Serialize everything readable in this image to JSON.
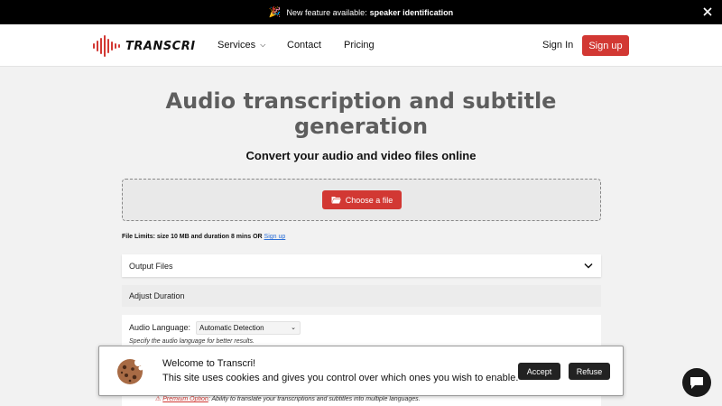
{
  "announcement": {
    "prefix": "New feature available:",
    "highlight": "speaker identification",
    "icon": "party-popper-icon"
  },
  "nav": {
    "logo_text": "TRANSCRI",
    "items": [
      "Services",
      "Contact",
      "Pricing"
    ],
    "signin": "Sign In",
    "signup": "Sign up"
  },
  "hero": {
    "title_line1": "Audio transcription and subtitle",
    "title_line2": "generation",
    "subtitle": "Convert your audio and video files online"
  },
  "upload": {
    "button": "Choose a file",
    "limits_text": "File Limits: size 10 MB and duration 8 mins OR",
    "limits_link": "Sign up"
  },
  "options": {
    "output_files": "Output Files",
    "adjust_duration": "Adjust Duration",
    "audio_language_label": "Audio Language:",
    "audio_language_value": "Automatic Detection",
    "audio_language_hint": "Specify the audio language for better results.",
    "premium_link": "Premium Option",
    "premium_text": ": Ability to translate your transcriptions and subtitles into multiple languages."
  },
  "cookie": {
    "title": "Welcome to Transcri!",
    "message": "This site uses cookies and gives you control over which ones you wish to enable.",
    "accept": "Accept",
    "refuse": "Refuse"
  },
  "colors": {
    "brand_red": "#d23833",
    "link_blue": "#2c6fd6"
  }
}
